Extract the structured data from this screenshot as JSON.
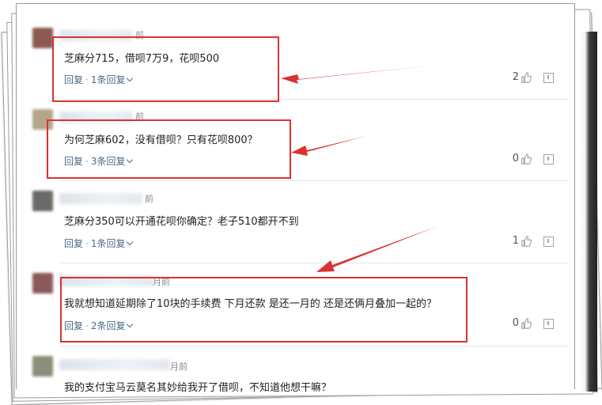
{
  "comments": [
    {
      "time": "前",
      "text": "芝麻分715，借呗7万9，花呗500",
      "reply": "回复",
      "sub_replies": "1条回复",
      "likes": "2"
    },
    {
      "time": "前",
      "text": "为何芝麻602，没有借呗？只有花呗800？",
      "reply": "回复",
      "sub_replies": "3条回复",
      "likes": "0"
    },
    {
      "time": "前",
      "text": "芝麻分350可以开通花呗你确定？老子510都开不到",
      "reply": "回复",
      "sub_replies": "1条回复",
      "likes": "1"
    },
    {
      "time": "月前",
      "text": "我就想知道延期除了10块的手续费 下月还款 是还一月的 还是还俩月叠加一起的？",
      "reply": "回复",
      "sub_replies": "2条回复",
      "likes": "0"
    },
    {
      "time": "月前",
      "text": "我的支付宝马云莫名其妙给我开了借呗，不知道他想干嘛？"
    }
  ],
  "colors": {
    "highlight": "#d93232",
    "link": "#4a6a8a"
  },
  "icons": {
    "like": "thumbs-up-icon",
    "report": "report-icon"
  }
}
